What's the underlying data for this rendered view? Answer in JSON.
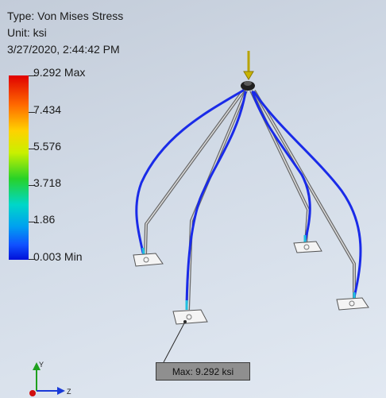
{
  "info": {
    "type_line": "Type: Von Mises Stress",
    "unit_line": "Unit: ksi",
    "date_line": "3/27/2020, 2:44:42 PM"
  },
  "legend": {
    "labels": [
      "9.292 Max",
      "7.434",
      "5.576",
      "3.718",
      "1.86",
      "0.003 Min"
    ],
    "max_value": 9.292,
    "min_value": 0.003,
    "unit": "ksi"
  },
  "probe": {
    "label": "Max: 9.292 ksi"
  },
  "triad": {
    "y_label": "Y",
    "z_label": "Z"
  },
  "colors": {
    "deformed_shape": "#1a2be8",
    "load_arrow": "#c9b400",
    "probe_box": "#8f8f8f"
  }
}
